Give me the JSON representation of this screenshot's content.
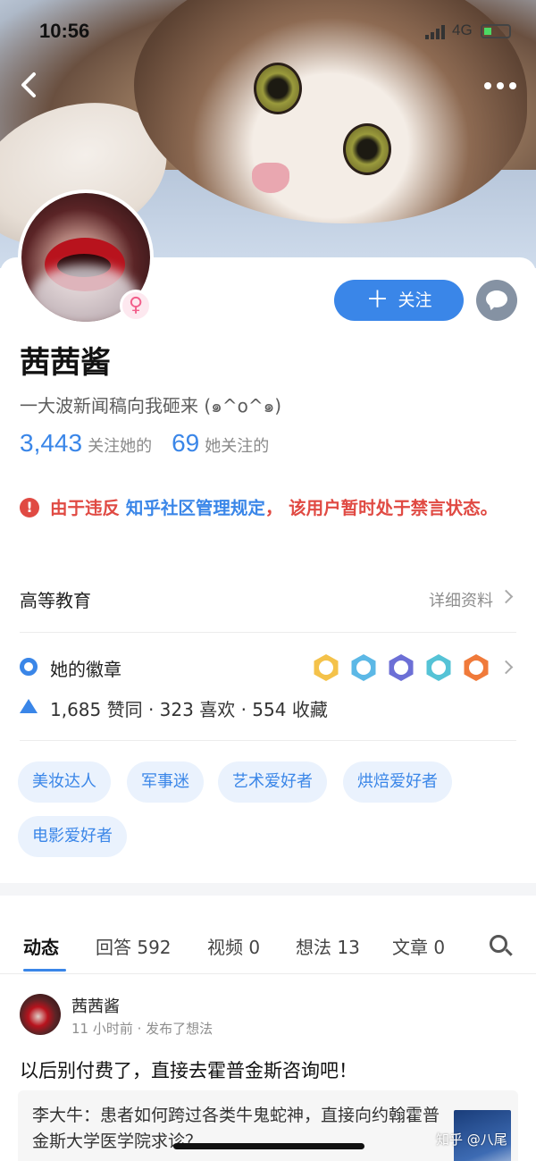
{
  "status_bar": {
    "time": "10:56",
    "network": "4G"
  },
  "profile": {
    "name": "茜茜酱",
    "gender_symbol": "♀",
    "bio": "一大波新闻稿向我砸来 (๑^ο^๑)",
    "followers_count": "3,443",
    "followers_label": "关注她的",
    "following_count": "69",
    "following_label": "她关注的"
  },
  "actions": {
    "follow_label": "关注",
    "plus": "＋"
  },
  "ban_notice": {
    "icon": "!",
    "prefix": "由于违反",
    "link": "知乎社区管理规定",
    "suffix": "， 该用户暂时处于禁言状态。"
  },
  "education": {
    "label": "高等教育",
    "detail_link": "详细资料"
  },
  "badges": {
    "label": "她的徽章",
    "icons": [
      {
        "name": "badge-1-icon",
        "color": "#f4c24a"
      },
      {
        "name": "badge-2-icon",
        "color": "#5cb8e6"
      },
      {
        "name": "badge-3-icon",
        "color": "#6c6fd6"
      },
      {
        "name": "badge-4-icon",
        "color": "#55c3d6"
      },
      {
        "name": "badge-5-icon",
        "color": "#f07a3a"
      }
    ]
  },
  "stats_line": "1,685 赞同 · 323 喜欢 · 554 收藏",
  "tags": [
    "美妆达人",
    "军事迷",
    "艺术爱好者",
    "烘焙爱好者",
    "电影爱好者"
  ],
  "tabs": [
    {
      "label": "动态"
    },
    {
      "label": "回答 592"
    },
    {
      "label": "视频 0"
    },
    {
      "label": "想法 13"
    },
    {
      "label": "文章 0"
    }
  ],
  "feed": {
    "author": "茜茜酱",
    "meta": "11 小时前 · 发布了想法",
    "content": "以后别付费了，直接去霍普金斯咨询吧！",
    "quote_text": "李大牛：患者如何跨过各类牛鬼蛇神，直接向约翰霍普金斯大学医学院求诊？"
  },
  "watermark": "知乎 @八尾",
  "colors": {
    "accent": "#3a86e8",
    "danger": "#e04a43",
    "tag_bg": "#eaf2fd"
  }
}
